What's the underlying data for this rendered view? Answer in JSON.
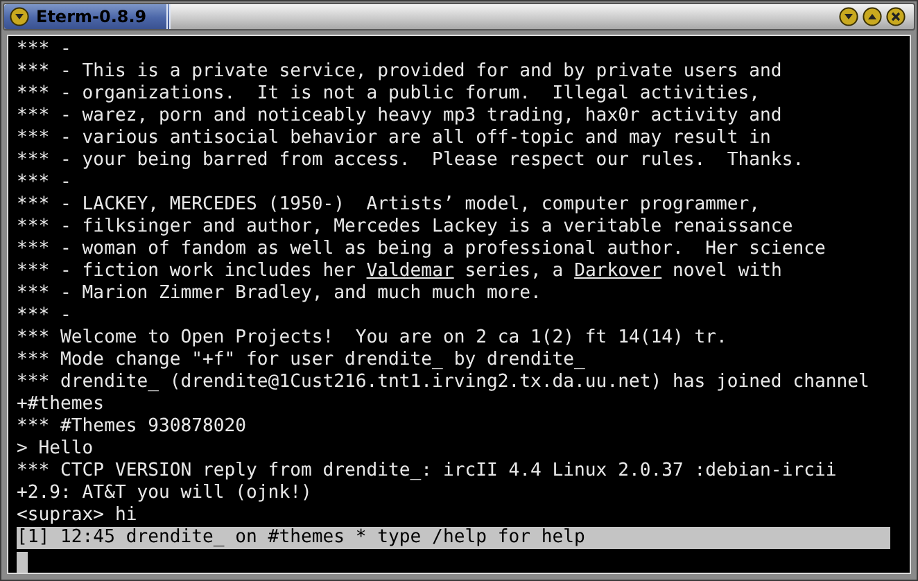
{
  "window": {
    "title": "Eterm-0.8.9"
  },
  "terminal": {
    "lines": [
      {
        "text": "*** -"
      },
      {
        "text": "*** - This is a private service, provided for and by private users and"
      },
      {
        "text": "*** - organizations.  It is not a public forum.  Illegal activities,"
      },
      {
        "text": "*** - warez, porn and noticeably heavy mp3 trading, hax0r activity and"
      },
      {
        "text": "*** - various antisocial behavior are all off-topic and may result in"
      },
      {
        "text": "*** - your being barred from access.  Please respect our rules.  Thanks."
      },
      {
        "text": "*** -"
      },
      {
        "text": "*** - LACKEY, MERCEDES (1950-)  Artists’ model, computer programmer,"
      },
      {
        "text": "*** - filksinger and author, Mercedes Lackey is a veritable renaissance"
      },
      {
        "text": "*** - woman of fandom as well as being a professional author.  Her science"
      },
      {
        "parts": [
          {
            "text": "*** - fiction work includes her ",
            "underline": false
          },
          {
            "text": "Valdemar",
            "underline": true
          },
          {
            "text": " series, a ",
            "underline": false
          },
          {
            "text": "Darkover",
            "underline": true
          },
          {
            "text": " novel with",
            "underline": false
          }
        ]
      },
      {
        "text": "*** - Marion Zimmer Bradley, and much much more."
      },
      {
        "text": "*** -"
      },
      {
        "text": "*** Welcome to Open Projects!  You are on 2 ca 1(2) ft 14(14) tr."
      },
      {
        "text": "*** Mode change \"+f\" for user drendite_ by drendite_"
      },
      {
        "text": "*** drendite_ (drendite@1Cust216.tnt1.irving2.tx.da.uu.net) has joined channel"
      },
      {
        "text": "+#themes"
      },
      {
        "text": "*** #Themes 930878020"
      },
      {
        "text": "> Hello"
      },
      {
        "text": "*** CTCP VERSION reply from drendite_: ircII 4.4 Linux 2.0.37 :debian-ircii"
      },
      {
        "text": "+2.9: AT&T you will (ojnk!)"
      },
      {
        "text": "<suprax> hi"
      }
    ],
    "status_bar": "[1] 12:45 drendite_ on #themes * type /help for help"
  }
}
